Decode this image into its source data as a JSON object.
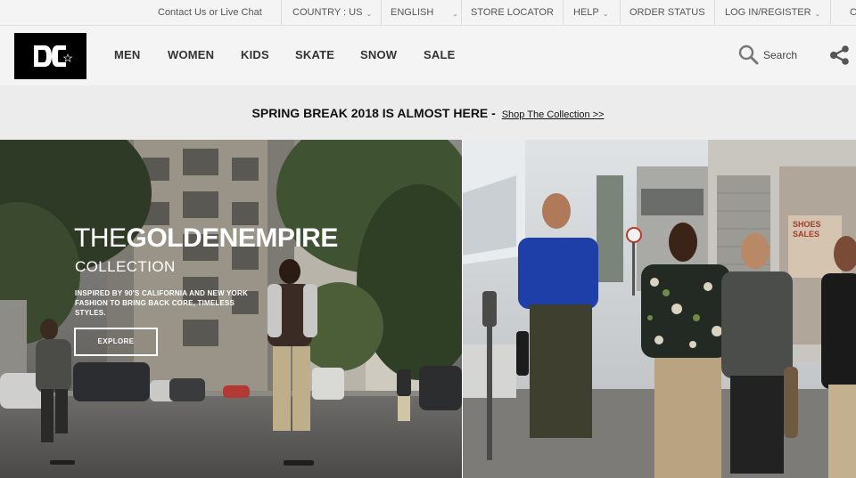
{
  "utility_bar": {
    "contact": "Contact Us or Live Chat",
    "country": "COUNTRY : US",
    "language": "ENGLISH",
    "store_locator": "STORE LOCATOR",
    "help": "HELP",
    "order_status": "ORDER STATUS",
    "login": "LOG IN/REGISTER"
  },
  "nav": {
    "logo_alt": "DC",
    "items": [
      "MEN",
      "WOMEN",
      "KIDS",
      "SKATE",
      "SNOW",
      "SALE"
    ],
    "search_label": "Search"
  },
  "promo": {
    "headline": "SPRING BREAK 2018 IS ALMOST HERE -",
    "link": "Shop The Collection >>"
  },
  "hero": {
    "title_light": "THE",
    "title_bold": "GOLDENEMPIRE",
    "subtitle": "COLLECTION",
    "description": "INSPIRED BY 90'S CALIFORNIA AND NEW YORK FASHION TO BRING BACK CORE, TIMELESS STYLES.",
    "cta": "EXPLORE",
    "right_sign": [
      "SHOES",
      "SALES"
    ]
  },
  "colors": {
    "utility_bg": "#f4f4f4",
    "promo_bg": "#ececec",
    "logo_bg": "#000000",
    "shirt_blue": "#1f3fa8"
  },
  "icons": {
    "search": "search-icon",
    "share": "share-icon",
    "caret": "chevron-down-icon"
  }
}
